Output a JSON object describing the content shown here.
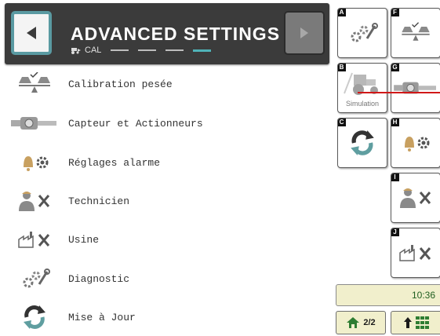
{
  "header": {
    "title": "ADVANCED SETTINGS",
    "subtitle": "CAL",
    "back_icon": "arrow-left-icon",
    "next_icon": "arrow-right-icon",
    "accent_color": "#4fb3b8"
  },
  "menu": {
    "items": [
      {
        "label": "Calibration pesée",
        "icon": "scale-calibration-icon"
      },
      {
        "label": "Capteur et Actionneurs",
        "icon": "sensor-icon"
      },
      {
        "label": "Réglages alarme",
        "icon": "alarm-settings-icon"
      },
      {
        "label": "Technicien",
        "icon": "technician-icon"
      },
      {
        "label": "Usine",
        "icon": "factory-icon"
      },
      {
        "label": "Diagnostic",
        "icon": "diagnostic-icon"
      },
      {
        "label": "Mise à Jour",
        "icon": "update-icon"
      }
    ]
  },
  "softkeys": {
    "A": {
      "letter": "A",
      "icon": "diagnostic-icon"
    },
    "B": {
      "letter": "B",
      "icon": "tractor-icon",
      "label": "Simulation"
    },
    "C": {
      "letter": "C",
      "icon": "update-icon"
    },
    "F": {
      "letter": "F",
      "icon": "scale-calibration-icon"
    },
    "G": {
      "letter": "G",
      "icon": "sensor-icon"
    },
    "H": {
      "letter": "H",
      "icon": "alarm-settings-icon"
    },
    "I": {
      "letter": "I",
      "icon": "technician-icon"
    },
    "J": {
      "letter": "J",
      "icon": "factory-icon"
    }
  },
  "status": {
    "time": "10:36",
    "page": "2/2"
  }
}
